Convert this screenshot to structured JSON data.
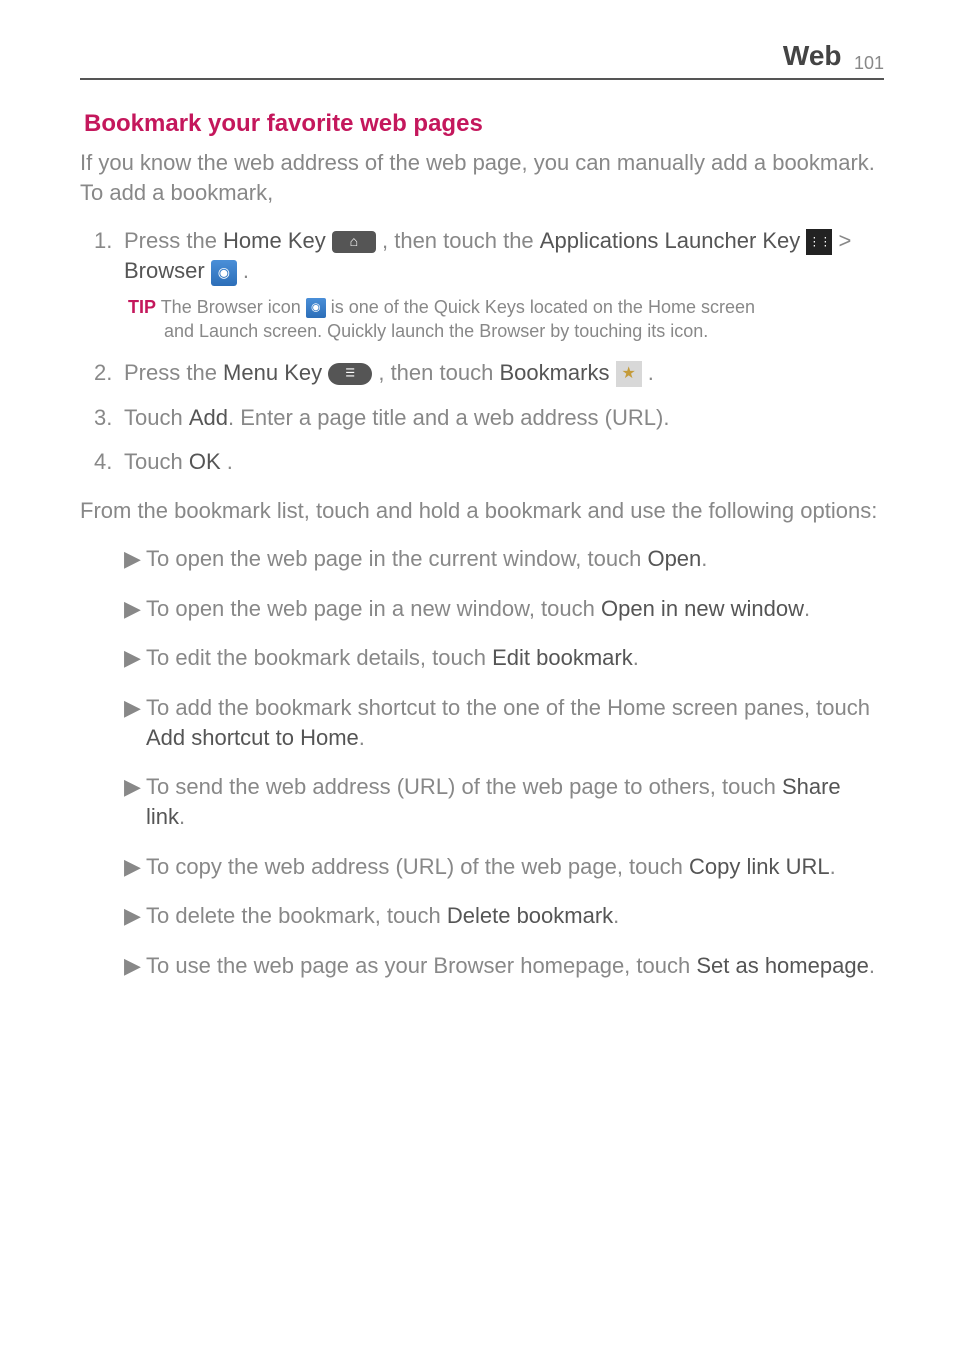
{
  "header": {
    "title": "Web",
    "page": "101"
  },
  "section": {
    "title": "Bookmark your favorite web pages",
    "intro": "If you know the web address of the web page, you can manually add a bookmark. To add a bookmark,"
  },
  "steps": {
    "s1_a": "Press the ",
    "s1_home": "Home Key",
    "s1_b": " , then touch the ",
    "s1_apps": "Applications Launcher Key",
    "s1_c": " > ",
    "s1_browser": "Browser",
    "s1_d": " .",
    "tip_label": "TIP",
    "tip_a": " The Browser icon ",
    "tip_b": " is one of the Quick Keys located on the Home screen",
    "tip_c": "and Launch screen. Quickly launch the Browser by touching its icon.",
    "s2_a": "Press the ",
    "s2_menu": "Menu Key",
    "s2_b": " , then touch ",
    "s2_book": "Bookmarks",
    "s2_c": " .",
    "s3_a": "Touch ",
    "s3_add": "Add",
    "s3_b": ". Enter a page title and a web address (URL).",
    "s4_a": "Touch ",
    "s4_ok": "OK",
    "s4_b": " ."
  },
  "bridge": "From the bookmark list, touch and hold a bookmark and use the following options:",
  "options": {
    "o1_a": "To open the web page in the current window, touch ",
    "o1_b": "Open",
    "o1_c": ".",
    "o2_a": "To open the web page in a new window, touch ",
    "o2_b": "Open in new window",
    "o2_c": ".",
    "o3_a": "To edit the bookmark details, touch ",
    "o3_b": "Edit bookmark",
    "o3_c": ".",
    "o4_a": "To add the bookmark shortcut to the one of the Home screen panes, touch ",
    "o4_b": "Add shortcut to Home",
    "o4_c": ".",
    "o5_a": "To send the web address (URL) of the web page to others, touch ",
    "o5_b": "Share link",
    "o5_c": ".",
    "o6_a": "To copy the web address (URL) of the web page, touch ",
    "o6_b": "Copy link URL",
    "o6_c": ".",
    "o7_a": "To delete the bookmark, touch ",
    "o7_b": "Delete bookmark",
    "o7_c": ".",
    "o8_a": "To use the web page as your Browser homepage, touch ",
    "o8_b": "Set as homepage",
    "o8_c": "."
  }
}
